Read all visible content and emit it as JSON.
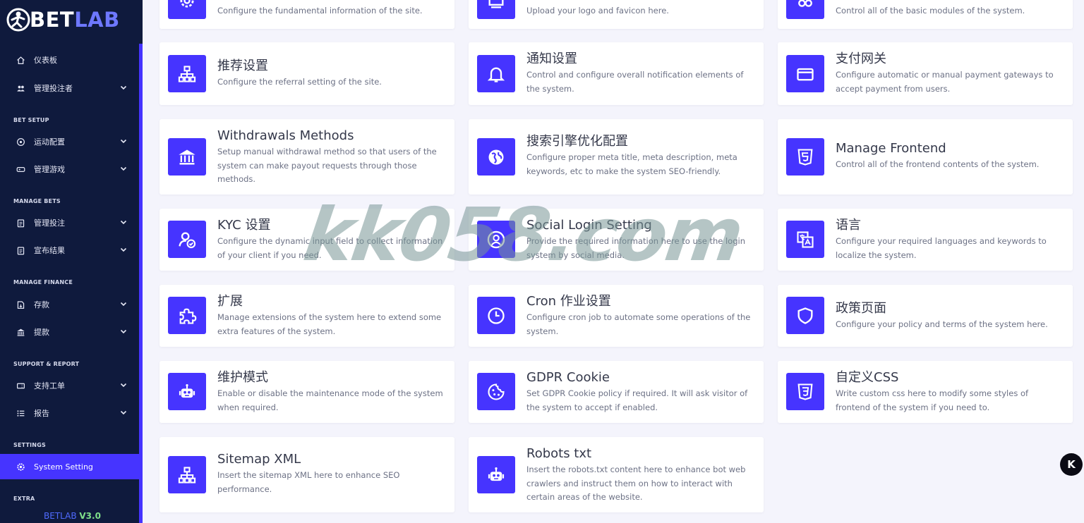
{
  "app": {
    "brand_main": "BET",
    "brand_accent": "LAB",
    "brand_color": "#4634ff",
    "sidebar_bg": "#0f1a3d"
  },
  "sidebar": {
    "items": [
      {
        "label": "仪表板",
        "icon": "home-icon",
        "has_submenu": false
      },
      {
        "label": "管理投注者",
        "icon": "users-icon",
        "has_submenu": true
      },
      {
        "label": "运动配置",
        "icon": "target-icon",
        "has_submenu": true
      },
      {
        "label": "管理游戏",
        "icon": "gamepad-icon",
        "has_submenu": true
      },
      {
        "label": "管理投注",
        "icon": "clipboard-icon",
        "has_submenu": true
      },
      {
        "label": "宣布结果",
        "icon": "clipboard-list-icon",
        "has_submenu": true
      },
      {
        "label": "存款",
        "icon": "deposit-icon",
        "has_submenu": true
      },
      {
        "label": "提款",
        "icon": "bank-icon",
        "has_submenu": true
      },
      {
        "label": "支持工单",
        "icon": "ticket-icon",
        "has_submenu": true
      },
      {
        "label": "报告",
        "icon": "list-icon",
        "has_submenu": true
      },
      {
        "label": "System Setting",
        "icon": "gear-icon",
        "has_submenu": false,
        "active": true
      }
    ],
    "sections": [
      "BET SETUP",
      "MANAGE BETS",
      "MANAGE FINANCE",
      "SUPPORT & REPORT",
      "SETTINGS",
      "EXTRA"
    ],
    "version_brand": "BETLAB",
    "version_number": "V3.0"
  },
  "cards": [
    {
      "title": "",
      "desc": "Configure the fundamental information of the site.",
      "icon": "gear-icon"
    },
    {
      "title": "",
      "desc": "Upload your logo and favicon here.",
      "icon": "image-icon"
    },
    {
      "title": "",
      "desc": "Control all of the basic modules of the system.",
      "icon": "modules-icon"
    },
    {
      "title": "推荐设置",
      "desc": "Configure the referral setting of the site.",
      "icon": "sitemap-icon"
    },
    {
      "title": "通知设置",
      "desc": "Control and configure overall notification elements of the system.",
      "icon": "bell-icon"
    },
    {
      "title": "支付网关",
      "desc": "Configure automatic or manual payment gateways to accept payment from users.",
      "icon": "credit-card-icon"
    },
    {
      "title": "Withdrawals Methods",
      "desc": "Setup manual withdrawal method so that users of the system can make payout requests through those methods.",
      "icon": "bank-icon"
    },
    {
      "title": "搜索引擎优化配置",
      "desc": "Configure proper meta title, meta description, meta keywords, etc to make the system SEO-friendly.",
      "icon": "globe-icon"
    },
    {
      "title": "Manage Frontend",
      "desc": "Control all of the frontend contents of the system.",
      "icon": "html5-icon"
    },
    {
      "title": "KYC 设置",
      "desc": "Configure the dynamic input field to collect information of your client if you need.",
      "icon": "user-check-icon"
    },
    {
      "title": "Social Login Setting",
      "desc": "Provide the required information here to use the login system by social media.",
      "icon": "user-circle-icon"
    },
    {
      "title": "语言",
      "desc": "Configure your required languages and keywords to localize the system.",
      "icon": "language-icon"
    },
    {
      "title": "扩展",
      "desc": "Manage extensions of the system here to extend some extra features of the system.",
      "icon": "puzzle-icon"
    },
    {
      "title": "Cron 作业设置",
      "desc": "Configure cron job to automate some operations of the system.",
      "icon": "clock-icon"
    },
    {
      "title": "政策页面",
      "desc": "Configure your policy and terms of the system here.",
      "icon": "shield-icon"
    },
    {
      "title": "维护模式",
      "desc": "Enable or disable the maintenance mode of the system when required.",
      "icon": "robot-icon"
    },
    {
      "title": "GDPR Cookie",
      "desc": "Set GDPR Cookie policy if required. It will ask visitor of the system to accept if enabled.",
      "icon": "cookie-icon"
    },
    {
      "title": "自定义CSS",
      "desc": "Write custom css here to modify some styles of frontend of the system if you need to.",
      "icon": "css3-icon"
    },
    {
      "title": "Sitemap XML",
      "desc": "Insert the sitemap XML here to enhance SEO performance.",
      "icon": "sitemap-icon"
    },
    {
      "title": "Robots txt",
      "desc": "Insert the robots.txt content here to enhance bot web crawlers and instruct them on how to interact with certain areas of the website.",
      "icon": "robot-icon"
    }
  ],
  "overlay": {
    "watermark_text": "kk058.com",
    "float_button_label": "K"
  }
}
